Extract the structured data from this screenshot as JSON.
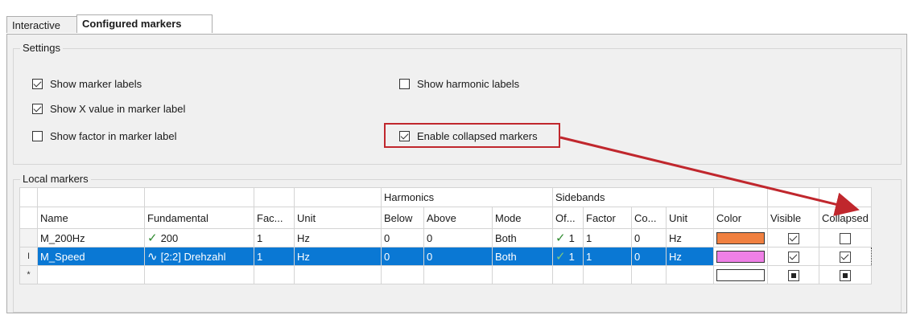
{
  "tabs": [
    {
      "label": "Interactive",
      "active": false
    },
    {
      "label": "Configured markers",
      "active": true
    }
  ],
  "settings": {
    "title": "Settings",
    "checkboxes": [
      {
        "label": "Show marker labels",
        "checked": true
      },
      {
        "label": "Show X value in marker label",
        "checked": true
      },
      {
        "label": "Show factor in marker label",
        "checked": false
      },
      {
        "label": "Show harmonic labels",
        "checked": false
      },
      {
        "label": "Enable collapsed markers",
        "checked": true
      }
    ]
  },
  "local_markers": {
    "title": "Local markers",
    "group_headers": {
      "harmonics": "Harmonics",
      "sidebands": "Sidebands"
    },
    "columns": [
      "Name",
      "Fundamental",
      "Fac...",
      "Unit",
      "Below",
      "Above",
      "Mode",
      "Of...",
      "Factor",
      "Co...",
      "Unit",
      "Color",
      "Visible",
      "Collapsed"
    ],
    "rows": [
      {
        "marker": "",
        "name": "M_200Hz",
        "fundamental_icon": "checkmark-icon",
        "fundamental": "200",
        "factor": "1",
        "unit": "Hz",
        "below": "0",
        "above": "0",
        "mode": "Both",
        "sb_offset": "1",
        "sb_factor": "1",
        "sb_count": "0",
        "sb_unit": "Hz",
        "color": "#f08040",
        "visible": "checked",
        "collapsed": "unchecked"
      },
      {
        "marker": "I",
        "name": "M_Speed",
        "fundamental_icon": "waveform-icon",
        "fundamental": "[2:2] Drehzahl",
        "factor": "1",
        "unit": "Hz",
        "below": "0",
        "above": "0",
        "mode": "Both",
        "sb_offset": "1",
        "sb_factor": "1",
        "sb_count": "0",
        "sb_unit": "Hz",
        "color": "#ef80e6",
        "visible": "checked",
        "collapsed": "checked"
      },
      {
        "marker": "*",
        "name": "",
        "fundamental": "",
        "factor": "",
        "unit": "",
        "below": "",
        "above": "",
        "mode": "",
        "sb_offset": "",
        "sb_factor": "",
        "sb_count": "",
        "sb_unit": "",
        "color": "#ffffff",
        "visible": "indeterminate",
        "collapsed": "indeterminate"
      }
    ]
  },
  "colors": {
    "selection": "#0a78d4",
    "annotation": "#c0272d"
  }
}
